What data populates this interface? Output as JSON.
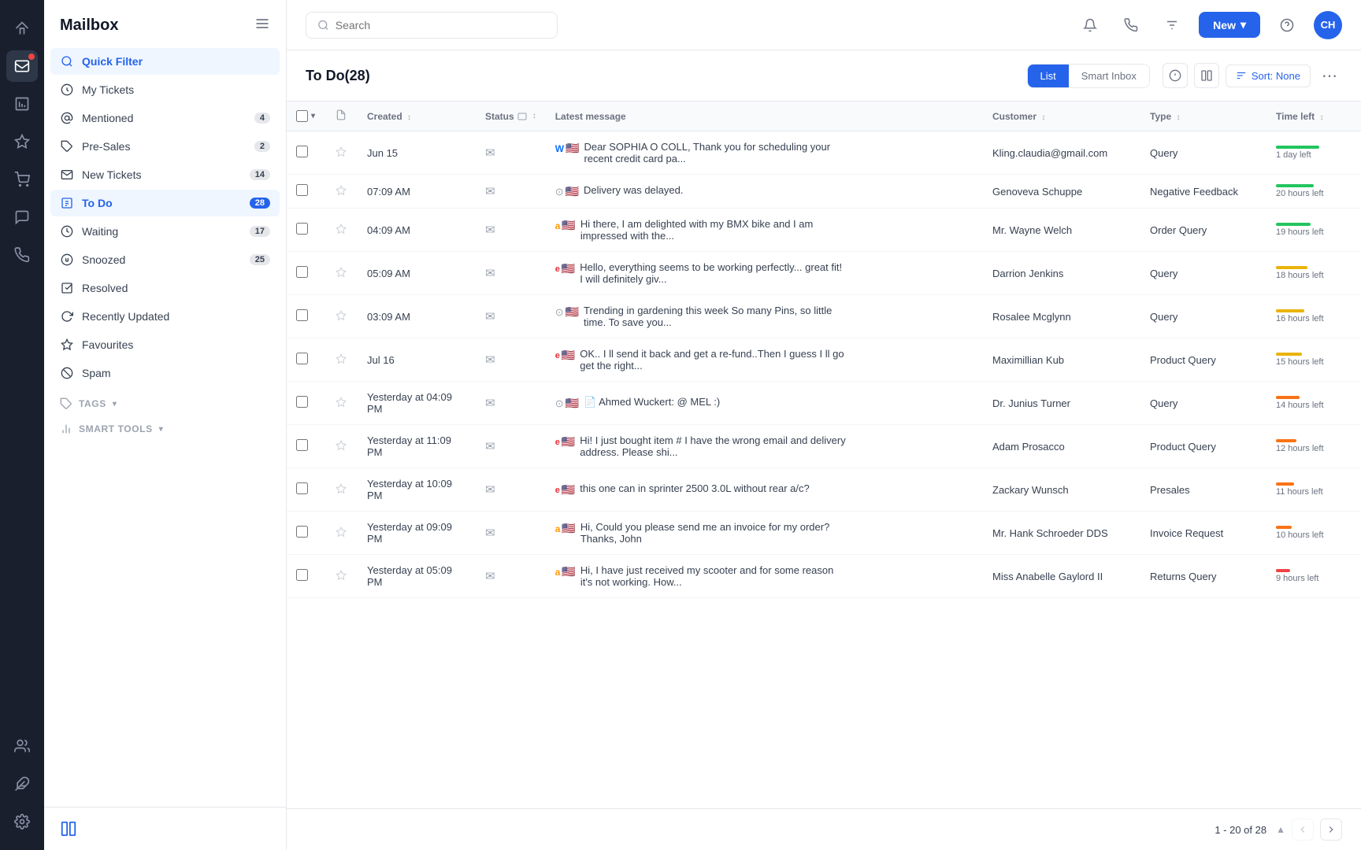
{
  "app": {
    "title": "Mailbox"
  },
  "topbar": {
    "search_placeholder": "Search",
    "new_label": "New",
    "avatar_initials": "CH"
  },
  "sidebar": {
    "nav_items": [
      {
        "id": "quick-filter",
        "label": "Quick Filter",
        "badge": null,
        "active": true
      },
      {
        "id": "my-tickets",
        "label": "My Tickets",
        "badge": null,
        "active": false
      },
      {
        "id": "mentioned",
        "label": "Mentioned",
        "badge": "4",
        "active": false
      },
      {
        "id": "pre-sales",
        "label": "Pre-Sales",
        "badge": "2",
        "active": false
      },
      {
        "id": "new-tickets",
        "label": "New Tickets",
        "badge": "14",
        "active": false
      },
      {
        "id": "to-do",
        "label": "To Do",
        "badge": "28",
        "active": true
      },
      {
        "id": "waiting",
        "label": "Waiting",
        "badge": "17",
        "active": false
      },
      {
        "id": "snoozed",
        "label": "Snoozed",
        "badge": "25",
        "active": false
      },
      {
        "id": "resolved",
        "label": "Resolved",
        "badge": null,
        "active": false
      },
      {
        "id": "recently-updated",
        "label": "Recently Updated",
        "badge": null,
        "active": false
      },
      {
        "id": "favourites",
        "label": "Favourites",
        "badge": null,
        "active": false
      },
      {
        "id": "spam",
        "label": "Spam",
        "badge": null,
        "active": false
      }
    ],
    "tags_label": "TAGS",
    "smart_tools_label": "SMART TOOLS"
  },
  "content": {
    "title": "To Do",
    "count": "28",
    "tab_list": "List",
    "tab_smart_inbox": "Smart Inbox",
    "sort_label": "Sort: None",
    "columns": {
      "created": "Created",
      "status": "Status",
      "latest_message": "Latest message",
      "customer": "Customer",
      "type": "Type",
      "time_left": "Time left"
    },
    "rows": [
      {
        "created": "Jun 15",
        "status_icon": "✉",
        "source": "wix",
        "flag": "🇺🇸",
        "message": "Dear SOPHIA O COLL, Thank you for scheduling your recent credit card pa...",
        "customer": "Kling.claudia@gmail.com",
        "type": "Query",
        "time_left_label": "1 day left",
        "time_bar_class": "time-green",
        "time_bar_width": "55"
      },
      {
        "created": "07:09 AM",
        "status_icon": "✉",
        "source": "globe",
        "flag": "🇺🇸",
        "message": "Delivery was delayed.",
        "customer": "Genoveva Schuppe",
        "type": "Negative Feedback",
        "time_left_label": "20 hours left",
        "time_bar_class": "time-green",
        "time_bar_width": "48"
      },
      {
        "created": "04:09 AM",
        "status_icon": "✉",
        "source": "amazon",
        "flag": "🇺🇸",
        "message": "Hi there, I am delighted with my BMX bike and I am impressed with the...",
        "customer": "Mr. Wayne Welch",
        "type": "Order Query",
        "time_left_label": "19 hours left",
        "time_bar_class": "time-green",
        "time_bar_width": "44"
      },
      {
        "created": "05:09 AM",
        "status_icon": "✉",
        "source": "ebay",
        "flag": "🇺🇸",
        "message": "Hello, everything seems to be working perfectly... great fit! I will definitely giv...",
        "customer": "Darrion Jenkins",
        "type": "Query",
        "time_left_label": "18 hours left",
        "time_bar_class": "time-yellow",
        "time_bar_width": "40"
      },
      {
        "created": "03:09 AM",
        "status_icon": "✉",
        "source": "globe",
        "flag": "🇺🇸",
        "message": "Trending in gardening this week So many Pins, so little time. To save you...",
        "customer": "Rosalee Mcglynn",
        "type": "Query",
        "time_left_label": "16 hours left",
        "time_bar_class": "time-yellow",
        "time_bar_width": "36"
      },
      {
        "created": "Jul 16",
        "status_icon": "✉",
        "source": "ebay",
        "flag": "🇺🇸",
        "message": "OK.. I ll send it back and get a re-fund..Then I guess I ll go get the right...",
        "customer": "Maximillian Kub",
        "type": "Product Query",
        "time_left_label": "15 hours left",
        "time_bar_class": "time-yellow",
        "time_bar_width": "33"
      },
      {
        "created": "Yesterday at 04:09 PM",
        "status_icon": "✉",
        "source": "globe",
        "flag": "🇺🇸",
        "message": "📄 Ahmed Wuckert: @ MEL :)",
        "customer": "Dr. Junius Turner",
        "type": "Query",
        "time_left_label": "14 hours left",
        "time_bar_class": "time-orange",
        "time_bar_width": "30"
      },
      {
        "created": "Yesterday at 11:09 PM",
        "status_icon": "✉",
        "source": "ebay",
        "flag": "🇺🇸",
        "message": "Hi! I just bought item # I have the wrong email and delivery address. Please shi...",
        "customer": "Adam Prosacco",
        "type": "Product Query",
        "time_left_label": "12 hours left",
        "time_bar_class": "time-orange",
        "time_bar_width": "26"
      },
      {
        "created": "Yesterday at 10:09 PM",
        "status_icon": "✉",
        "source": "ebay",
        "flag": "🇺🇸",
        "message": "this one can in sprinter 2500 3.0L without rear a/c?",
        "customer": "Zackary Wunsch",
        "type": "Presales",
        "time_left_label": "11 hours left",
        "time_bar_class": "time-orange",
        "time_bar_width": "23"
      },
      {
        "created": "Yesterday at 09:09 PM",
        "status_icon": "✉",
        "source": "amazon",
        "flag": "🇺🇸",
        "message": "Hi, Could you please send me an invoice for my order? Thanks, John",
        "customer": "Mr. Hank Schroeder DDS",
        "type": "Invoice Request",
        "time_left_label": "10 hours left",
        "time_bar_class": "time-orange",
        "time_bar_width": "20"
      },
      {
        "created": "Yesterday at 05:09 PM",
        "status_icon": "✉",
        "source": "amazon",
        "flag": "🇺🇸",
        "message": "Hi, I have just received my scooter and for some reason it's not working. How...",
        "customer": "Miss Anabelle Gaylord II",
        "type": "Returns Query",
        "time_left_label": "9 hours left",
        "time_bar_class": "time-red",
        "time_bar_width": "18"
      }
    ],
    "pagination": {
      "current": "1 - 20",
      "total": "28",
      "label": "1 - 20 of 28"
    }
  }
}
